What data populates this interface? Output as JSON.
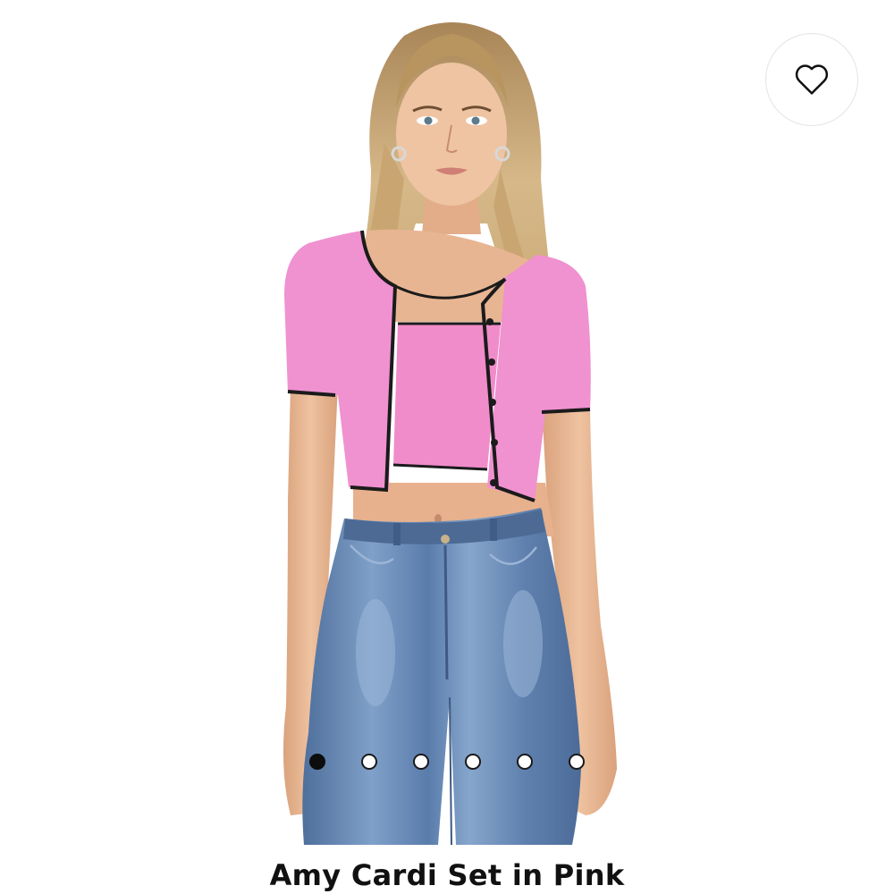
{
  "product": {
    "title": "Amy Cardi Set in Pink",
    "image_alt": "Model wearing pink cropped cardigan set with black trim and blue jeans"
  },
  "favorite": {
    "icon": "heart-outline-icon",
    "label": "Add to wishlist"
  },
  "carousel": {
    "total": 6,
    "active_index": 0
  },
  "colors": {
    "cardigan_pink": "#f08fd0",
    "trim_black": "#1b1b1b",
    "denim_blue": "#5c7fae",
    "hair_blonde": "#c9a978",
    "skin": "#e9b692"
  }
}
